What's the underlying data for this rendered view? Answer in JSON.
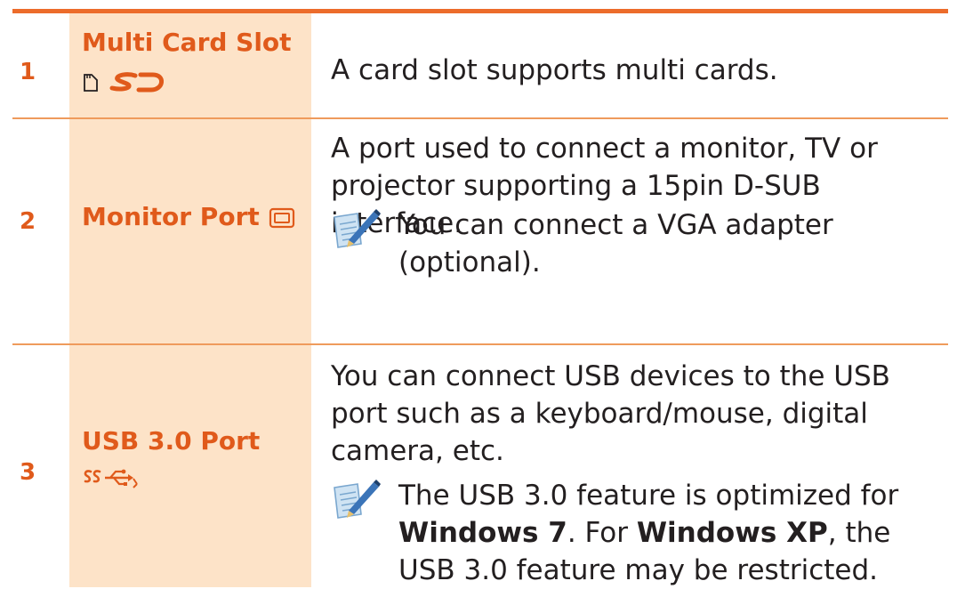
{
  "rows": [
    {
      "number": "1",
      "label": "Multi Card Slot",
      "icons": [
        "memory-card-icon",
        "sd-logo-icon"
      ],
      "description": "A card slot supports multi cards."
    },
    {
      "number": "2",
      "label": "Monitor Port",
      "icons": [
        "monitor-icon"
      ],
      "description": "A port used to connect a monitor, TV or projector supporting a 15pin D-SUB interface.",
      "note": "You can connect a VGA adapter (optional)."
    },
    {
      "number": "3",
      "label": "USB 3.0 Port",
      "icons": [
        "usb-superspeed-icon"
      ],
      "description": "You can connect USB devices to the USB port such as a keyboard/mouse, digital camera, etc.",
      "note": {
        "part1": "The USB 3.0 feature is optimized for ",
        "bold1": "Windows 7",
        "part2": ". For ",
        "bold2": "Windows XP",
        "part3": ", the USB 3.0 feature may be restricted."
      }
    }
  ],
  "colors": {
    "accent": "#ec6c2b",
    "label_background": "#fde3c8",
    "label_text": "#e05a1b",
    "body_text": "#231f20"
  }
}
